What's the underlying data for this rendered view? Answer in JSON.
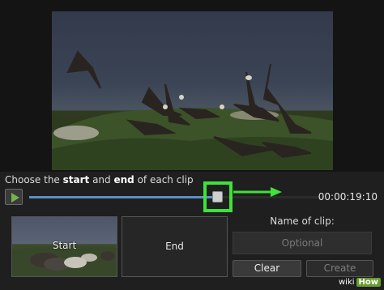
{
  "instruction": {
    "prefix": "Choose the ",
    "start_word": "start",
    "middle": " and ",
    "end_word": "end",
    "suffix": " of each clip"
  },
  "player": {
    "play_icon": "play-icon",
    "timestamp": "00:00:19:10",
    "progress": 0.64
  },
  "clips": {
    "start_label": "Start",
    "end_label": "End",
    "name_title": "Name of clip:",
    "name_placeholder": "Optional",
    "clear_label": "Clear",
    "create_label": "Create"
  },
  "watermark": {
    "wiki": "wiki",
    "how": "How"
  },
  "colors": {
    "highlight": "#3ee23a",
    "track_fill": "#5b8fc9",
    "play_icon": "#79b04a"
  }
}
